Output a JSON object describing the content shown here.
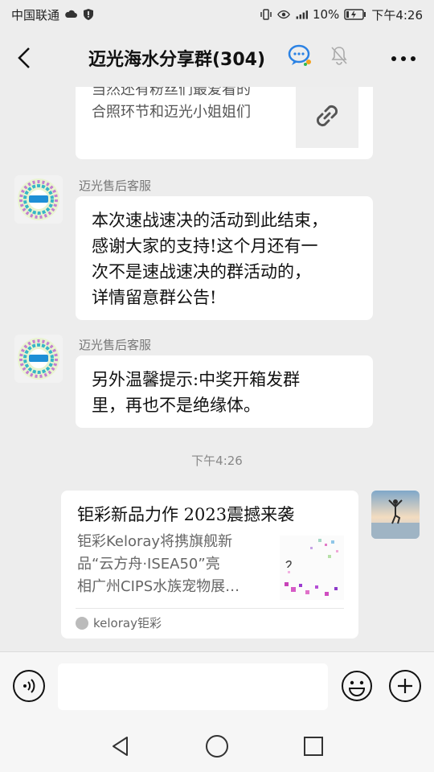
{
  "status_bar": {
    "carrier": "中国联通",
    "battery": "10%",
    "time": "下午4:26"
  },
  "header": {
    "title": "迈光海水分享群(304)",
    "back_icon": "chevron-left-icon",
    "more_icon": "more-dots-icon"
  },
  "messages": [
    {
      "type": "link-card-partial",
      "desc_line1": "当然还有粉丝们最爱看的",
      "desc_line2": "合照环节和迈光小姐姐们",
      "thumb_icon": "link-icon"
    },
    {
      "type": "text",
      "sender": "迈光售后客服",
      "lines": [
        "本次速战速决的活动到此结束，",
        "感谢大家的支持!这个月还有一",
        "次不是速战速决的群活动的，",
        "详情留意群公告!"
      ]
    },
    {
      "type": "text",
      "sender": "迈光售后客服",
      "lines": [
        "另外温馨提示:中奖开箱发群",
        "里，再也不是绝缘体。"
      ]
    }
  ],
  "timestamp": "下午4:26",
  "share_card": {
    "title": "钜彩新品力作 2023震撼来袭",
    "desc_line1": "钜彩Keloray将携旗舰新",
    "desc_line2": "品“云方舟·ISEA50”亮",
    "desc_line3": "相广州CIPS水族宠物展…",
    "source": "keloray钜彩"
  },
  "input": {
    "placeholder": ""
  }
}
